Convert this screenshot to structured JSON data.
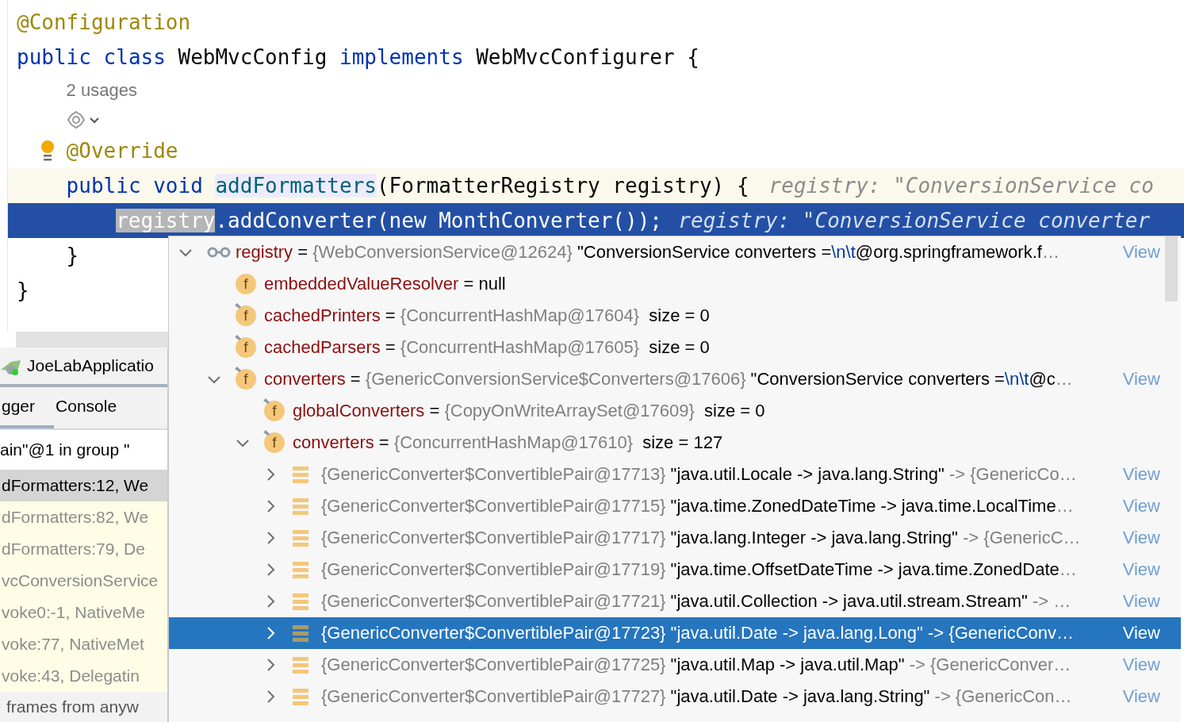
{
  "editor": {
    "lines": [
      {
        "kind": "code",
        "highlighted": false,
        "selected": false,
        "intention": false,
        "tokens": [
          {
            "kind": "annotation",
            "text": "@Configuration"
          }
        ]
      },
      {
        "kind": "code",
        "highlighted": false,
        "selected": false,
        "intention": false,
        "tokens": [
          {
            "kind": "keyword",
            "text": "public class "
          },
          {
            "kind": "plain",
            "text": "WebMvcConfig "
          },
          {
            "kind": "keyword",
            "text": "implements "
          },
          {
            "kind": "plain",
            "text": "WebMvcConfigurer {"
          }
        ],
        "children": [
          {
            "kind": "usages",
            "highlighted": false,
            "selected": false,
            "intention": false,
            "text": "2 usages"
          },
          {
            "kind": "inlay_icons",
            "highlighted": false,
            "selected": false,
            "intention": false
          },
          {
            "kind": "code",
            "highlighted": false,
            "selected": false,
            "intention": true,
            "tokens": [
              {
                "kind": "annotation",
                "text": "@Override"
              }
            ]
          },
          {
            "kind": "code",
            "highlighted": true,
            "selected": false,
            "intention": false,
            "tokens": [
              {
                "kind": "keyword",
                "text": "public void "
              },
              {
                "kind": "method",
                "text": "addFormatters"
              },
              {
                "kind": "plain",
                "text": "(FormatterRegistry registry) {"
              },
              {
                "kind": "hint",
                "text": "registry: \"ConversionService co"
              }
            ],
            "children": [
              {
                "kind": "code",
                "highlighted": false,
                "selected": true,
                "intention": false,
                "tokens": [
                  {
                    "kind": "reference",
                    "text": "registry"
                  },
                  {
                    "kind": "plain",
                    "text": ".addConverter(new MonthConverter());"
                  },
                  {
                    "kind": "hint",
                    "text": "registry: \"ConversionService converter"
                  }
                ]
              }
            ]
          },
          {
            "kind": "code",
            "highlighted": false,
            "selected": false,
            "intention": false,
            "tokens": [
              {
                "kind": "plain",
                "text": "}"
              }
            ]
          }
        ]
      },
      {
        "kind": "code",
        "highlighted": false,
        "selected": false,
        "intention": false,
        "tokens": [
          {
            "kind": "plain",
            "text": "}"
          }
        ]
      }
    ]
  },
  "debug_panel": {
    "title": "JoeLabApplicatio",
    "tabs": [
      {
        "label": "gger",
        "selected": true
      },
      {
        "label": "Console",
        "selected": false
      }
    ],
    "thread": "ain\"@1 in group \"",
    "frames": [
      {
        "text": "dFormatters:12, We",
        "selected": true,
        "library": false
      },
      {
        "text": "dFormatters:82, We",
        "selected": false,
        "library": true
      },
      {
        "text": "dFormatters:79, De",
        "selected": false,
        "library": true
      },
      {
        "text": "vcConversionService",
        "selected": false,
        "library": true
      },
      {
        "text": "voke0:-1, NativeMe",
        "selected": false,
        "library": true
      },
      {
        "text": "voke:77, NativeMet",
        "selected": false,
        "library": true
      },
      {
        "text": "voke:43, Delegatin",
        "selected": false,
        "library": true
      }
    ],
    "hint": "frames from anyw"
  },
  "variables_popup": {
    "tree": [
      {
        "kind": "watch",
        "name": "registry",
        "expanded": true,
        "selected": false,
        "value": [
          {
            "kind": "plain",
            "text": " = "
          },
          {
            "kind": "type",
            "text": "{WebConversionService@12624}"
          },
          {
            "kind": "plain",
            "text": " \"ConversionService converters ="
          },
          {
            "kind": "escape",
            "text": "\\n\\t"
          },
          {
            "kind": "plain",
            "text": "@org.springframework.f"
          },
          {
            "kind": "type",
            "text": "…"
          }
        ],
        "view": "View",
        "children": [
          {
            "kind": "field",
            "badge": "f",
            "pinned": false,
            "name": "embeddedValueResolver",
            "selected": false,
            "value": [
              {
                "kind": "plain",
                "text": " = null"
              }
            ]
          },
          {
            "kind": "field",
            "badge": "f",
            "pinned": true,
            "name": "cachedPrinters",
            "selected": false,
            "value": [
              {
                "kind": "plain",
                "text": " = "
              },
              {
                "kind": "type",
                "text": "{ConcurrentHashMap@17604}"
              },
              {
                "kind": "plain",
                "text": "  size = 0"
              }
            ]
          },
          {
            "kind": "field",
            "badge": "f",
            "pinned": true,
            "name": "cachedParsers",
            "selected": false,
            "value": [
              {
                "kind": "plain",
                "text": " = "
              },
              {
                "kind": "type",
                "text": "{ConcurrentHashMap@17605}"
              },
              {
                "kind": "plain",
                "text": "  size = 0"
              }
            ]
          },
          {
            "kind": "field",
            "badge": "f",
            "pinned": true,
            "name": "converters",
            "expanded": true,
            "selected": false,
            "value": [
              {
                "kind": "plain",
                "text": " = "
              },
              {
                "kind": "type",
                "text": "{GenericConversionService$Converters@17606}"
              },
              {
                "kind": "plain",
                "text": " \"ConversionService converters ="
              },
              {
                "kind": "escape",
                "text": "\\n\\t"
              },
              {
                "kind": "plain",
                "text": "@c"
              },
              {
                "kind": "type",
                "text": "…"
              }
            ],
            "view": "View",
            "children": [
              {
                "kind": "field",
                "badge": "f",
                "pinned": true,
                "name": "globalConverters",
                "selected": false,
                "value": [
                  {
                    "kind": "plain",
                    "text": " = "
                  },
                  {
                    "kind": "type",
                    "text": "{CopyOnWriteArraySet@17609}"
                  },
                  {
                    "kind": "plain",
                    "text": "  size = 0"
                  }
                ]
              },
              {
                "kind": "field",
                "badge": "f",
                "pinned": true,
                "name": "converters",
                "expanded": true,
                "selected": false,
                "value": [
                  {
                    "kind": "plain",
                    "text": " = "
                  },
                  {
                    "kind": "type",
                    "text": "{ConcurrentHashMap@17610}"
                  },
                  {
                    "kind": "plain",
                    "text": "  size = 127"
                  }
                ],
                "children": [
                  {
                    "kind": "entry",
                    "expanded": false,
                    "selected": false,
                    "value": [
                      {
                        "kind": "type",
                        "text": "{GenericConverter$ConvertiblePair@17713}"
                      },
                      {
                        "kind": "plain",
                        "text": " \"java.util.Locale -> java.lang.String\""
                      },
                      {
                        "kind": "type",
                        "text": " -> {GenericCo…"
                      }
                    ],
                    "view": "View"
                  },
                  {
                    "kind": "entry",
                    "expanded": false,
                    "selected": false,
                    "value": [
                      {
                        "kind": "type",
                        "text": "{GenericConverter$ConvertiblePair@17715}"
                      },
                      {
                        "kind": "plain",
                        "text": " \"java.time.ZonedDateTime -> java.time.LocalTime"
                      },
                      {
                        "kind": "type",
                        "text": "…"
                      }
                    ],
                    "view": "View"
                  },
                  {
                    "kind": "entry",
                    "expanded": false,
                    "selected": false,
                    "value": [
                      {
                        "kind": "type",
                        "text": "{GenericConverter$ConvertiblePair@17717}"
                      },
                      {
                        "kind": "plain",
                        "text": " \"java.lang.Integer -> java.lang.String\""
                      },
                      {
                        "kind": "type",
                        "text": " -> {GenericC…"
                      }
                    ],
                    "view": "View"
                  },
                  {
                    "kind": "entry",
                    "expanded": false,
                    "selected": false,
                    "value": [
                      {
                        "kind": "type",
                        "text": "{GenericConverter$ConvertiblePair@17719}"
                      },
                      {
                        "kind": "plain",
                        "text": " \"java.time.OffsetDateTime -> java.time.ZonedDate"
                      },
                      {
                        "kind": "type",
                        "text": "…"
                      }
                    ],
                    "view": "View"
                  },
                  {
                    "kind": "entry",
                    "expanded": false,
                    "selected": false,
                    "value": [
                      {
                        "kind": "type",
                        "text": "{GenericConverter$ConvertiblePair@17721}"
                      },
                      {
                        "kind": "plain",
                        "text": " \"java.util.Collection -> java.util.stream.Stream\""
                      },
                      {
                        "kind": "type",
                        "text": " -> …"
                      }
                    ],
                    "view": "View"
                  },
                  {
                    "kind": "entry",
                    "expanded": false,
                    "selected": true,
                    "value": [
                      {
                        "kind": "type",
                        "text": "{GenericConverter$ConvertiblePair@17723}"
                      },
                      {
                        "kind": "plain",
                        "text": " \"java.util.Date -> java.lang.Long\""
                      },
                      {
                        "kind": "type",
                        "text": " -> {GenericConv…"
                      }
                    ],
                    "view": "View"
                  },
                  {
                    "kind": "entry",
                    "expanded": false,
                    "selected": false,
                    "value": [
                      {
                        "kind": "type",
                        "text": "{GenericConverter$ConvertiblePair@17725}"
                      },
                      {
                        "kind": "plain",
                        "text": " \"java.util.Map -> java.util.Map\""
                      },
                      {
                        "kind": "type",
                        "text": " -> {GenericConver…"
                      }
                    ],
                    "view": "View"
                  },
                  {
                    "kind": "entry",
                    "expanded": false,
                    "selected": false,
                    "value": [
                      {
                        "kind": "type",
                        "text": "{GenericConverter$ConvertiblePair@17727}"
                      },
                      {
                        "kind": "plain",
                        "text": " \"java.util.Date -> java.lang.String\""
                      },
                      {
                        "kind": "type",
                        "text": " -> {GenericCon…"
                      }
                    ],
                    "view": "View"
                  }
                ]
              }
            ]
          }
        ]
      }
    ]
  }
}
